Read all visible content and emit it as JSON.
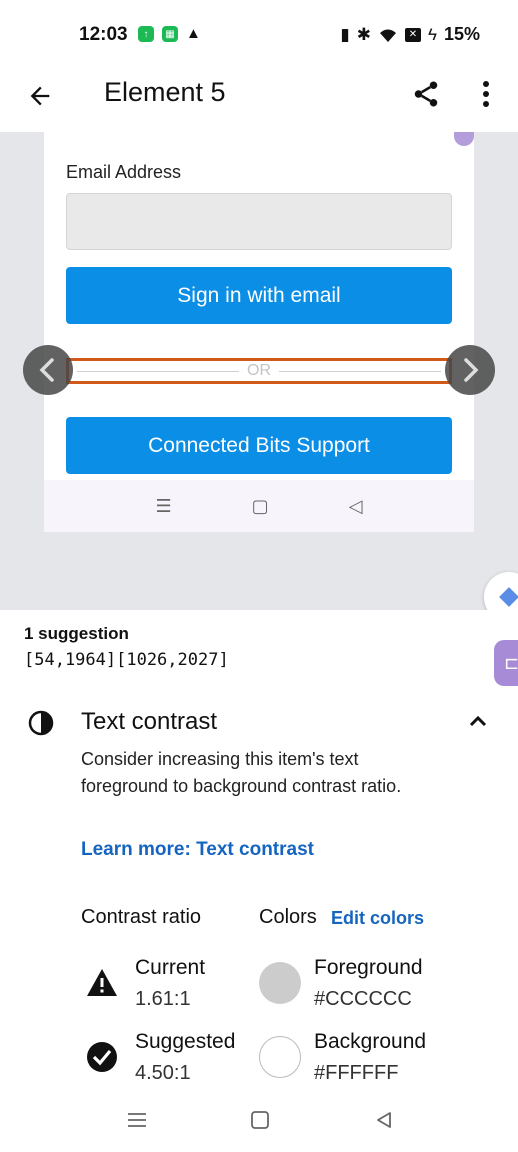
{
  "status_bar": {
    "time": "12:03",
    "battery": "15%"
  },
  "app_bar": {
    "title": "Element 5"
  },
  "preview": {
    "email_label": "Email Address",
    "signin_button": "Sign in with email",
    "or_text": "OR",
    "support_button": "Connected Bits Support"
  },
  "sheet": {
    "suggestion_count": "1 suggestion",
    "coords": "[54,1964][1026,2027]",
    "check_title": "Text contrast",
    "description": "Consider increasing this item's text foreground to background contrast ratio.",
    "learn_more": "Learn more: Text contrast",
    "contrast_heading": "Contrast ratio",
    "colors_heading": "Colors",
    "edit_colors": "Edit colors",
    "current_label": "Current",
    "current_value": "1.61:1",
    "suggested_label": "Suggested",
    "suggested_value": "4.50:1",
    "foreground_label": "Foreground",
    "foreground_value": "#CCCCCC",
    "background_label": "Background",
    "background_value": "#FFFFFF"
  },
  "colors": {
    "accent_blue": "#0b8ee6",
    "link_blue": "#1565c0",
    "highlight": "#d15a1a",
    "foreground_swatch": "#CCCCCC",
    "background_swatch": "#FFFFFF"
  }
}
